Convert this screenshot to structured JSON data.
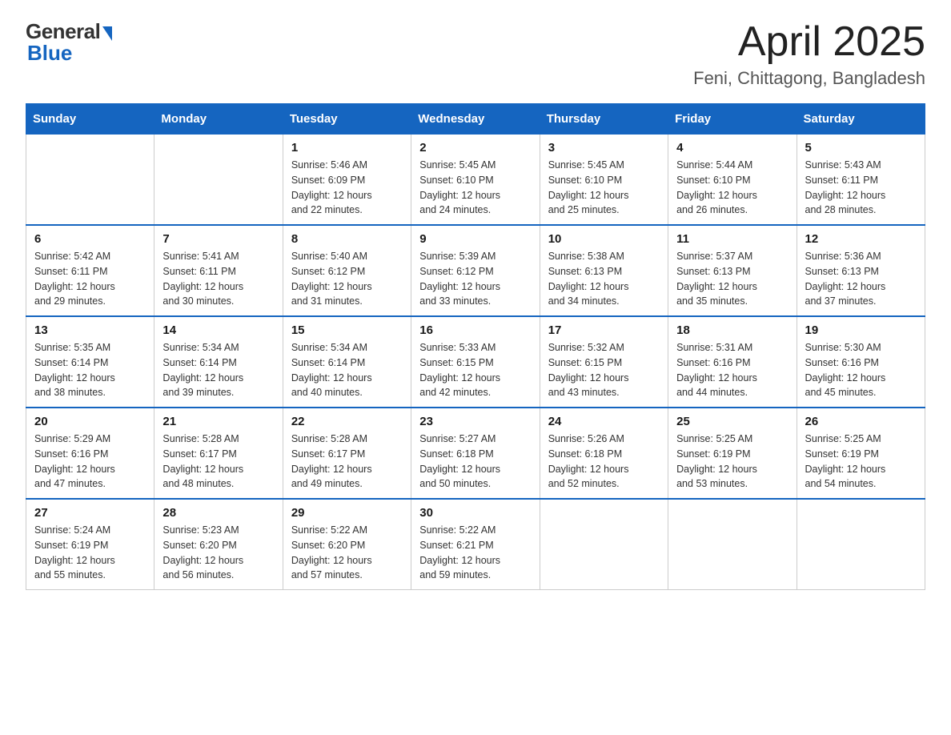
{
  "header": {
    "logo_general": "General",
    "logo_blue": "Blue",
    "month_title": "April 2025",
    "location": "Feni, Chittagong, Bangladesh"
  },
  "days_of_week": [
    "Sunday",
    "Monday",
    "Tuesday",
    "Wednesday",
    "Thursday",
    "Friday",
    "Saturday"
  ],
  "weeks": [
    [
      {
        "day": "",
        "info": ""
      },
      {
        "day": "",
        "info": ""
      },
      {
        "day": "1",
        "info": "Sunrise: 5:46 AM\nSunset: 6:09 PM\nDaylight: 12 hours\nand 22 minutes."
      },
      {
        "day": "2",
        "info": "Sunrise: 5:45 AM\nSunset: 6:10 PM\nDaylight: 12 hours\nand 24 minutes."
      },
      {
        "day": "3",
        "info": "Sunrise: 5:45 AM\nSunset: 6:10 PM\nDaylight: 12 hours\nand 25 minutes."
      },
      {
        "day": "4",
        "info": "Sunrise: 5:44 AM\nSunset: 6:10 PM\nDaylight: 12 hours\nand 26 minutes."
      },
      {
        "day": "5",
        "info": "Sunrise: 5:43 AM\nSunset: 6:11 PM\nDaylight: 12 hours\nand 28 minutes."
      }
    ],
    [
      {
        "day": "6",
        "info": "Sunrise: 5:42 AM\nSunset: 6:11 PM\nDaylight: 12 hours\nand 29 minutes."
      },
      {
        "day": "7",
        "info": "Sunrise: 5:41 AM\nSunset: 6:11 PM\nDaylight: 12 hours\nand 30 minutes."
      },
      {
        "day": "8",
        "info": "Sunrise: 5:40 AM\nSunset: 6:12 PM\nDaylight: 12 hours\nand 31 minutes."
      },
      {
        "day": "9",
        "info": "Sunrise: 5:39 AM\nSunset: 6:12 PM\nDaylight: 12 hours\nand 33 minutes."
      },
      {
        "day": "10",
        "info": "Sunrise: 5:38 AM\nSunset: 6:13 PM\nDaylight: 12 hours\nand 34 minutes."
      },
      {
        "day": "11",
        "info": "Sunrise: 5:37 AM\nSunset: 6:13 PM\nDaylight: 12 hours\nand 35 minutes."
      },
      {
        "day": "12",
        "info": "Sunrise: 5:36 AM\nSunset: 6:13 PM\nDaylight: 12 hours\nand 37 minutes."
      }
    ],
    [
      {
        "day": "13",
        "info": "Sunrise: 5:35 AM\nSunset: 6:14 PM\nDaylight: 12 hours\nand 38 minutes."
      },
      {
        "day": "14",
        "info": "Sunrise: 5:34 AM\nSunset: 6:14 PM\nDaylight: 12 hours\nand 39 minutes."
      },
      {
        "day": "15",
        "info": "Sunrise: 5:34 AM\nSunset: 6:14 PM\nDaylight: 12 hours\nand 40 minutes."
      },
      {
        "day": "16",
        "info": "Sunrise: 5:33 AM\nSunset: 6:15 PM\nDaylight: 12 hours\nand 42 minutes."
      },
      {
        "day": "17",
        "info": "Sunrise: 5:32 AM\nSunset: 6:15 PM\nDaylight: 12 hours\nand 43 minutes."
      },
      {
        "day": "18",
        "info": "Sunrise: 5:31 AM\nSunset: 6:16 PM\nDaylight: 12 hours\nand 44 minutes."
      },
      {
        "day": "19",
        "info": "Sunrise: 5:30 AM\nSunset: 6:16 PM\nDaylight: 12 hours\nand 45 minutes."
      }
    ],
    [
      {
        "day": "20",
        "info": "Sunrise: 5:29 AM\nSunset: 6:16 PM\nDaylight: 12 hours\nand 47 minutes."
      },
      {
        "day": "21",
        "info": "Sunrise: 5:28 AM\nSunset: 6:17 PM\nDaylight: 12 hours\nand 48 minutes."
      },
      {
        "day": "22",
        "info": "Sunrise: 5:28 AM\nSunset: 6:17 PM\nDaylight: 12 hours\nand 49 minutes."
      },
      {
        "day": "23",
        "info": "Sunrise: 5:27 AM\nSunset: 6:18 PM\nDaylight: 12 hours\nand 50 minutes."
      },
      {
        "day": "24",
        "info": "Sunrise: 5:26 AM\nSunset: 6:18 PM\nDaylight: 12 hours\nand 52 minutes."
      },
      {
        "day": "25",
        "info": "Sunrise: 5:25 AM\nSunset: 6:19 PM\nDaylight: 12 hours\nand 53 minutes."
      },
      {
        "day": "26",
        "info": "Sunrise: 5:25 AM\nSunset: 6:19 PM\nDaylight: 12 hours\nand 54 minutes."
      }
    ],
    [
      {
        "day": "27",
        "info": "Sunrise: 5:24 AM\nSunset: 6:19 PM\nDaylight: 12 hours\nand 55 minutes."
      },
      {
        "day": "28",
        "info": "Sunrise: 5:23 AM\nSunset: 6:20 PM\nDaylight: 12 hours\nand 56 minutes."
      },
      {
        "day": "29",
        "info": "Sunrise: 5:22 AM\nSunset: 6:20 PM\nDaylight: 12 hours\nand 57 minutes."
      },
      {
        "day": "30",
        "info": "Sunrise: 5:22 AM\nSunset: 6:21 PM\nDaylight: 12 hours\nand 59 minutes."
      },
      {
        "day": "",
        "info": ""
      },
      {
        "day": "",
        "info": ""
      },
      {
        "day": "",
        "info": ""
      }
    ]
  ]
}
